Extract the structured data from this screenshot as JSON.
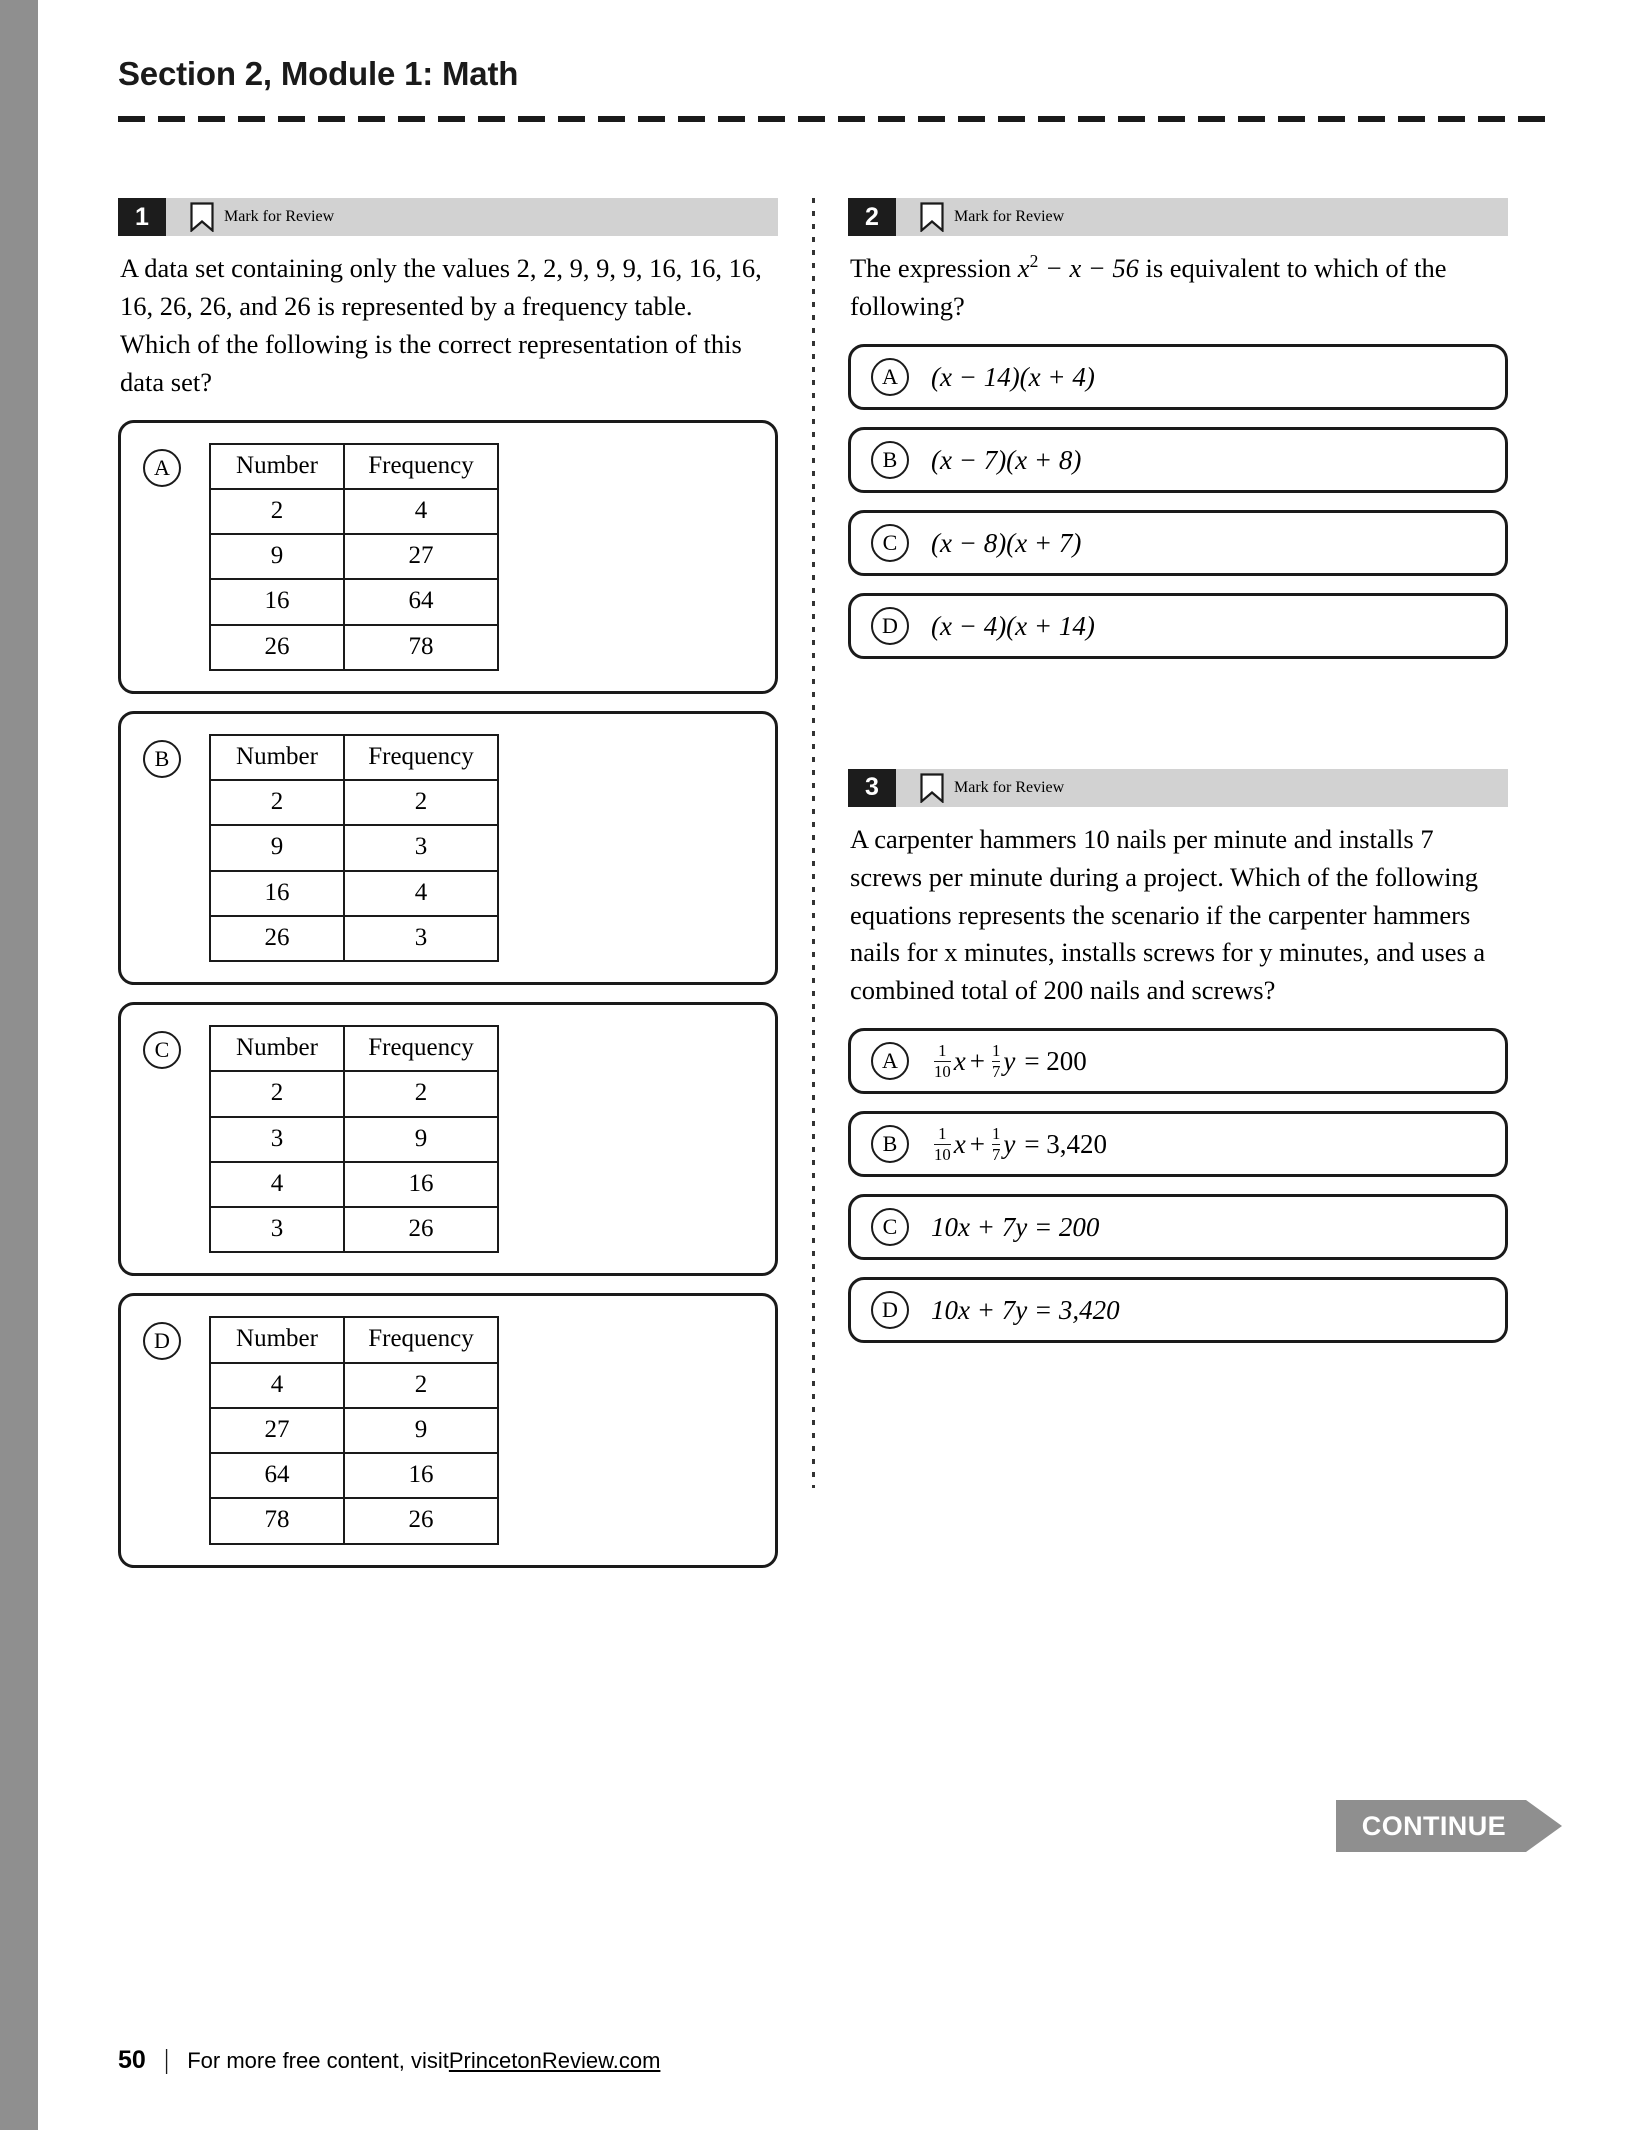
{
  "header": {
    "section_title": "Section 2, Module 1: Math"
  },
  "mark_for_review_label": "Mark for Review",
  "table_headers": {
    "number": "Number",
    "frequency": "Frequency"
  },
  "questions": [
    {
      "number": "1",
      "stem_parts": [
        "A data set containing only the values ",
        "2, 2, 9, 9, 9, 16, 16, 16, 16, 26, 26,",
        " and ",
        "26",
        " is represented by a frequency table. Which of the following is the correct representation of this data set?"
      ],
      "choices": [
        {
          "letter": "A",
          "rows": [
            {
              "number": "2",
              "frequency": "4"
            },
            {
              "number": "9",
              "frequency": "27"
            },
            {
              "number": "16",
              "frequency": "64"
            },
            {
              "number": "26",
              "frequency": "78"
            }
          ]
        },
        {
          "letter": "B",
          "rows": [
            {
              "number": "2",
              "frequency": "2"
            },
            {
              "number": "9",
              "frequency": "3"
            },
            {
              "number": "16",
              "frequency": "4"
            },
            {
              "number": "26",
              "frequency": "3"
            }
          ]
        },
        {
          "letter": "C",
          "rows": [
            {
              "number": "2",
              "frequency": "2"
            },
            {
              "number": "3",
              "frequency": "9"
            },
            {
              "number": "4",
              "frequency": "16"
            },
            {
              "number": "3",
              "frequency": "26"
            }
          ]
        },
        {
          "letter": "D",
          "rows": [
            {
              "number": "4",
              "frequency": "2"
            },
            {
              "number": "27",
              "frequency": "9"
            },
            {
              "number": "64",
              "frequency": "16"
            },
            {
              "number": "78",
              "frequency": "26"
            }
          ]
        }
      ]
    },
    {
      "number": "2",
      "stem_lead": "The expression ",
      "stem_expr_base": "x",
      "stem_expr_exp": "2",
      "stem_expr_rest": " − x − 56",
      "stem_tail": " is equivalent to which of the following?",
      "choices": [
        {
          "letter": "A",
          "text": "(x − 14)(x + 4)"
        },
        {
          "letter": "B",
          "text": "(x − 7)(x + 8)"
        },
        {
          "letter": "C",
          "text": "(x − 8)(x + 7)"
        },
        {
          "letter": "D",
          "text": "(x − 4)(x + 14)"
        }
      ]
    },
    {
      "number": "3",
      "stem": "A carpenter hammers 10 nails per minute and installs 7 screws per minute during a project. Which of the following equations represents the scenario if the carpenter hammers nails for x minutes, installs screws for y minutes, and uses a combined total of 200 nails and screws?",
      "choices": [
        {
          "letter": "A",
          "type": "fraction",
          "frac1_num": "1",
          "frac1_den": "10",
          "var1": "x",
          "plus": "+",
          "frac2_num": "1",
          "frac2_den": "7",
          "var2": "y",
          "equals": "= 200"
        },
        {
          "letter": "B",
          "type": "fraction",
          "frac1_num": "1",
          "frac1_den": "10",
          "var1": "x",
          "plus": "+",
          "frac2_num": "1",
          "frac2_den": "7",
          "var2": "y",
          "equals": "= 3,420"
        },
        {
          "letter": "C",
          "type": "plain",
          "text": "10x + 7y = 200"
        },
        {
          "letter": "D",
          "type": "plain",
          "text": "10x + 7y = 3,420"
        }
      ]
    }
  ],
  "continue_button": {
    "label": "CONTINUE"
  },
  "footer": {
    "page_number": "50",
    "text": "For more free content, visit ",
    "link": "PrincetonReview.com"
  },
  "colors": {
    "gutter": "#8f8f8f",
    "badge": "#1c1c1c",
    "bar": "#d2d2d2",
    "continue": "#8f8f8f"
  }
}
